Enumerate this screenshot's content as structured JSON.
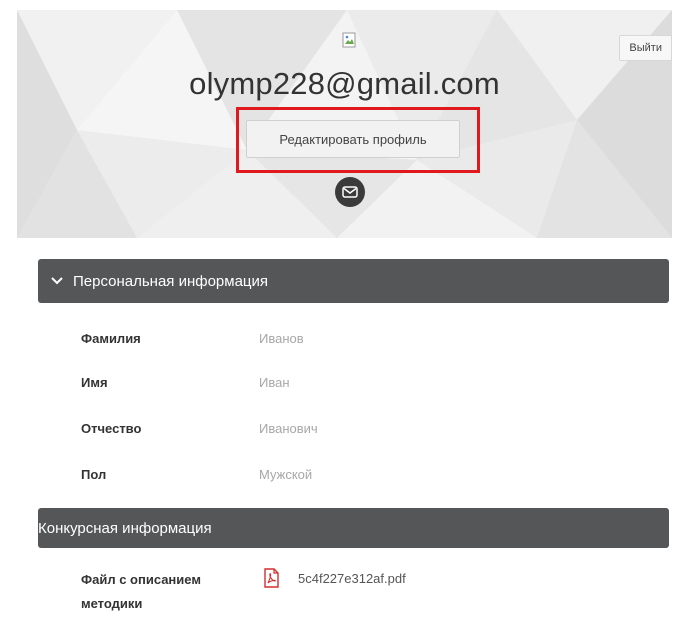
{
  "header": {
    "email": "olymp228@gmail.com",
    "logout_label": "Выйти",
    "edit_profile_label": "Редактировать профиль"
  },
  "sections": {
    "personal": {
      "title": "Персональная информация",
      "fields": [
        {
          "label": "Фамилия",
          "value": "Иванов"
        },
        {
          "label": "Имя",
          "value": "Иван"
        },
        {
          "label": "Отчество",
          "value": "Иванович"
        },
        {
          "label": "Пол",
          "value": "Мужской"
        }
      ]
    },
    "contest": {
      "title": "Конкурсная информация",
      "file_label": "Файл с описанием методики",
      "file_name": "5c4f227e312af.pdf"
    }
  },
  "colors": {
    "highlight": "#e0191e",
    "section_bg": "#555657",
    "pdf_icon": "#d32f2f"
  },
  "icons": {
    "avatar": "broken-image-icon",
    "mail": "envelope-icon",
    "chevron": "chevron-down-icon",
    "file": "pdf-file-icon"
  }
}
